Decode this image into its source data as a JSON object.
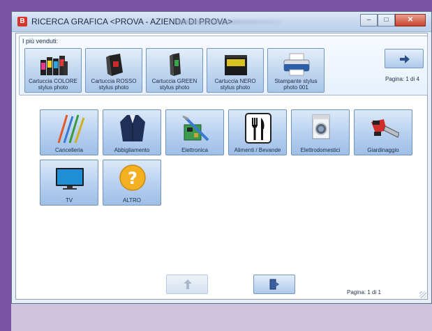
{
  "window": {
    "title": "RICERCA GRAFICA <PROVA - AZIENDA DI PROVA>",
    "controls": {
      "minimize": "–",
      "maximize": "□",
      "close": "✕"
    }
  },
  "best_sellers": {
    "label": "I più venduti:",
    "items": [
      {
        "label": "Cartuccia COLORE stylus photo",
        "icon": "color-ink-cartridges-icon"
      },
      {
        "label": "Cartuccia ROSSO stylus photo",
        "icon": "red-ink-cartridge-icon"
      },
      {
        "label": "Cartuccia GREEN stylus photo",
        "icon": "green-ink-cartridge-icon"
      },
      {
        "label": "Cartuccia NERO stylus photo",
        "icon": "black-ink-cartridge-icon"
      },
      {
        "label": "Stampante stylus photo 001",
        "icon": "printer-icon"
      }
    ],
    "next_icon": "arrow-right-icon",
    "pagination": "Pagina: 1 di 4"
  },
  "categories": [
    {
      "label": "Cancelleria",
      "icon": "pens-icon"
    },
    {
      "label": "Abbigliamento",
      "icon": "jacket-icon"
    },
    {
      "label": "Elettronica",
      "icon": "circuit-board-icon"
    },
    {
      "label": "Alimenti / Bevande",
      "icon": "fork-knife-icon"
    },
    {
      "label": "Elettrodomestici",
      "icon": "washing-machine-icon"
    },
    {
      "label": "Giardinaggio",
      "icon": "chainsaw-icon"
    },
    {
      "label": "TV",
      "icon": "tv-icon"
    },
    {
      "label": "ALTRO",
      "icon": "question-mark-icon"
    }
  ],
  "footer": {
    "back_icon": "arrow-up-icon",
    "exit_icon": "exit-door-icon",
    "pagination": "Pagina: 1 di 1"
  },
  "colors": {
    "desktop": "#7a54a3",
    "button_gradient_top": "#dbe9f8",
    "button_gradient_bottom": "#9fbfe6",
    "close_button": "#c9432b"
  }
}
